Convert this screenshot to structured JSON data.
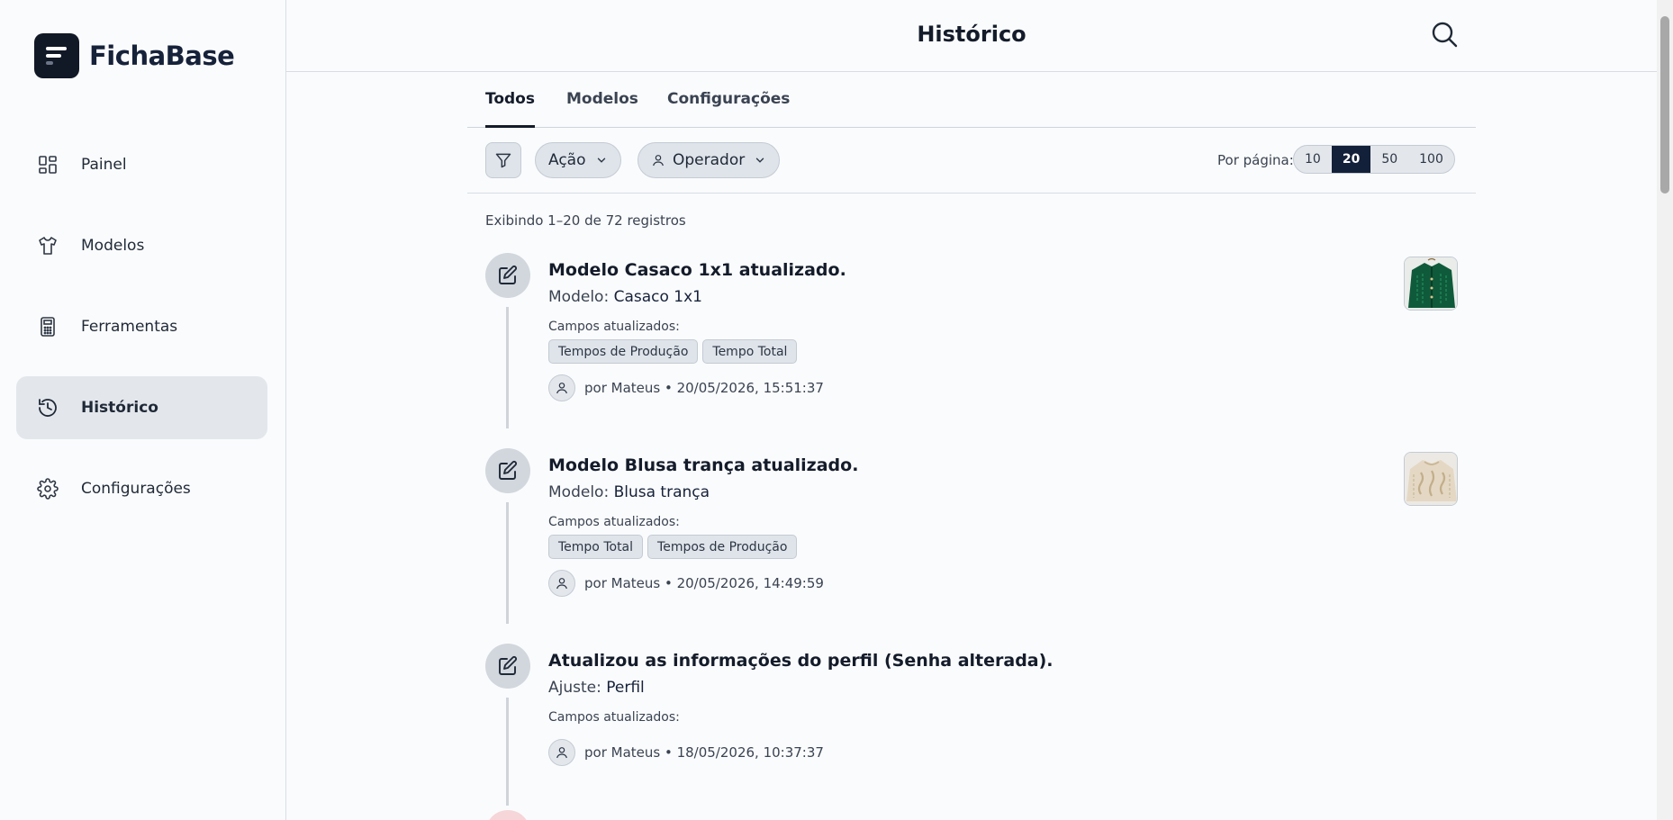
{
  "brand": {
    "name": "FichaBase"
  },
  "sidebar": {
    "items": [
      {
        "label": "Painel",
        "icon": "dashboard-icon"
      },
      {
        "label": "Modelos",
        "icon": "shirt-icon"
      },
      {
        "label": "Ferramentas",
        "icon": "calculator-icon"
      },
      {
        "label": "Histórico",
        "icon": "history-icon",
        "active": true
      },
      {
        "label": "Configurações",
        "icon": "gear-icon"
      }
    ]
  },
  "header": {
    "title": "Histórico"
  },
  "tabs": [
    {
      "label": "Todos",
      "active": true
    },
    {
      "label": "Modelos"
    },
    {
      "label": "Configurações"
    }
  ],
  "filters": {
    "action_label": "Ação",
    "operator_label": "Operador",
    "per_page_label": "Por página:",
    "per_page_options": [
      "10",
      "20",
      "50",
      "100"
    ],
    "per_page_selected": "20"
  },
  "summary": {
    "text": "Exibindo 1–20 de 72 registros"
  },
  "entries": [
    {
      "title": "Modelo Casaco 1x1 atualizado.",
      "sub_label": "Modelo:",
      "sub_value": "Casaco 1x1",
      "fields_label": "Campos atualizados:",
      "tags": [
        "Tempos de Produção",
        "Tempo Total"
      ],
      "byline": "por Mateus • 20/05/2026, 15:51:37",
      "thumbnail": "green-cardigan"
    },
    {
      "title": "Modelo Blusa trança atualizado.",
      "sub_label": "Modelo:",
      "sub_value": "Blusa trança",
      "fields_label": "Campos atualizados:",
      "tags": [
        "Tempo Total",
        "Tempos de Produção"
      ],
      "byline": "por Mateus • 20/05/2026, 14:49:59",
      "thumbnail": "cream-cable-sweater"
    },
    {
      "title": "Atualizou as informações do perfil (Senha alterada).",
      "sub_label": "Ajuste:",
      "sub_value": "Perfil",
      "fields_label": "Campos atualizados:",
      "tags": [],
      "byline": "por Mateus • 18/05/2026, 10:37:37"
    }
  ],
  "colors": {
    "accent": "#13203a",
    "active_nav": "#e3e7ec",
    "tag_bg": "#dfe4ea"
  }
}
